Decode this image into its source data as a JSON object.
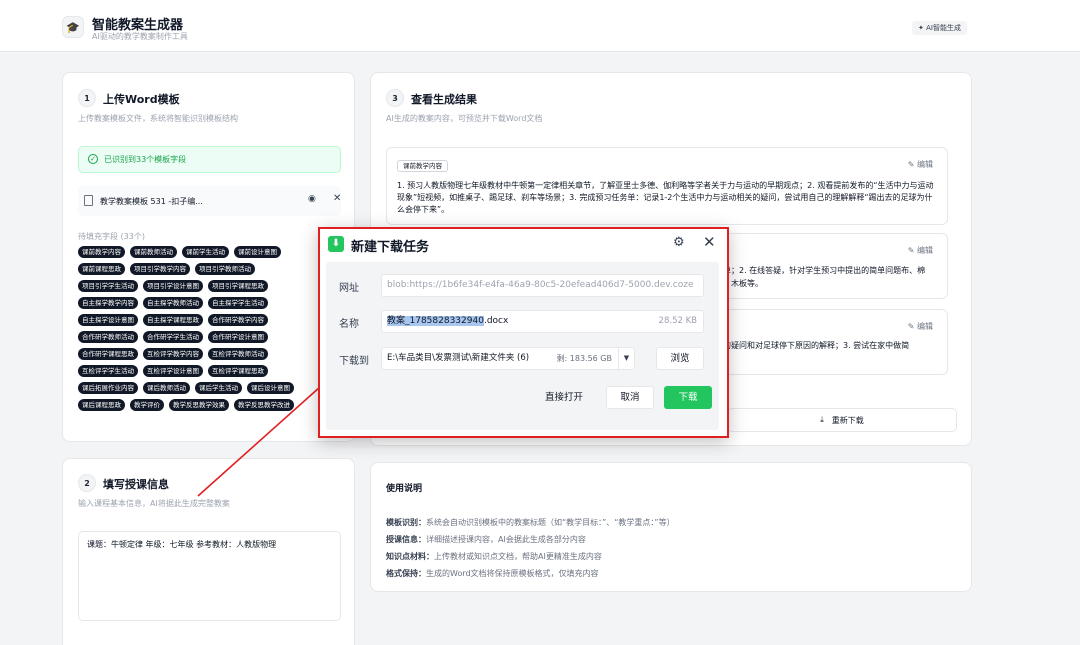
{
  "header": {
    "title": "智能教案生成器",
    "subtitle": "AI驱动的教学教案制作工具",
    "badge": "AI智能生成"
  },
  "upload": {
    "step": "1",
    "title": "上传Word模板",
    "desc": "上传教案模板文件，系统将智能识别模板结构",
    "success": "已识别到33个模板字段",
    "file_name": "教学教案模板 531 -扣子编...",
    "fields_label": "待填充字段 (33个)",
    "tags": [
      "课前教学内容",
      "课前教师活动",
      "课前学生活动",
      "课前设计意图",
      "课前课程思政",
      "项目引学教学内容",
      "项目引学教师活动",
      "项目引学学生活动",
      "项目引学设计意图",
      "项目引学课程思政",
      "自主探学教学内容",
      "自主探学教师活动",
      "自主探学学生活动",
      "自主探学设计意图",
      "自主探学课程思政",
      "合作研学教学内容",
      "合作研学教师活动",
      "合作研学学生活动",
      "合作研学设计意图",
      "合作研学课程思政",
      "互检评学教学内容",
      "互检评学教师活动",
      "互检评学学生活动",
      "互检评学设计意图",
      "互检评学课程思政",
      "课后拓展作业内容",
      "课后教师活动",
      "课后学生活动",
      "课后设计意图",
      "课后课程思政",
      "教学评价",
      "教学反思教学效果",
      "教学反思教学改进"
    ]
  },
  "info": {
    "step": "2",
    "title": "填写授课信息",
    "desc": "输入课程基本信息，AI将据此生成完整教案",
    "text": "课题：牛顿定律  年级：七年级  参考教材：人教版物理",
    "bottom": "3  …  …"
  },
  "results": {
    "step": "3",
    "title": "查看生成结果",
    "desc": "AI生成的教案内容，可预览并下载Word文档",
    "item1_tag": "课前教学内容",
    "edit_label": "编辑",
    "item1_text": "1. 预习人教版物理七年级教材中牛顿第一定律相关章节，了解亚里士多德、伽利略等学者关于力与运动的早期观点；2. 观看提前发布的“生活中力与运动现象”短视频，如推桌子、踢足球、刹车等场景；3. 完成预习任务单：记录1-2个生活中力与运动相关的疑问，尝试用自己的理解解释“踢出去的足球为什么会停下来”。",
    "item2_text": "务单；2. 在线答疑，针对学生预习中提出的简单问题布、棉布、木板等。",
    "item3_text": "已的疑问和对足球停下原因的解释；3. 尝试在家中做简",
    "regen": "重新下载"
  },
  "usage": {
    "title": "使用说明",
    "lines": [
      {
        "k": "模板识别：",
        "v": "系统会自动识别模板中的教案标题（如“教学目标：”、“教学重点：”等）"
      },
      {
        "k": "授课信息：",
        "v": "详细描述授课内容，AI会据此生成各部分内容"
      },
      {
        "k": "知识点材料：",
        "v": "上传教材或知识点文档，帮助AI更精准生成内容"
      },
      {
        "k": "格式保持：",
        "v": "生成的Word文档将保持原模板格式，仅填充内容"
      }
    ]
  },
  "dialog": {
    "title": "新建下载任务",
    "url_label": "网址",
    "url_value": "blob:https://1b6fe34f-e4fa-46a9-80c5-20efead406d7-5000.dev.coze",
    "name_label": "名称",
    "name_selected": "教案_1785828332940",
    "name_ext": ".docx",
    "name_size": "28.52 KB",
    "path_label": "下载到",
    "path_value": "E:\\车品类目\\发票测试\\新建文件夹 (6)",
    "path_free": "剩: 183.56 GB",
    "browse": "浏览",
    "open_direct": "直接打开",
    "cancel": "取消",
    "download": "下载"
  },
  "colors": {
    "accent_green": "#22c55e",
    "highlight_red": "#e02020",
    "tag_bg": "#111827"
  }
}
